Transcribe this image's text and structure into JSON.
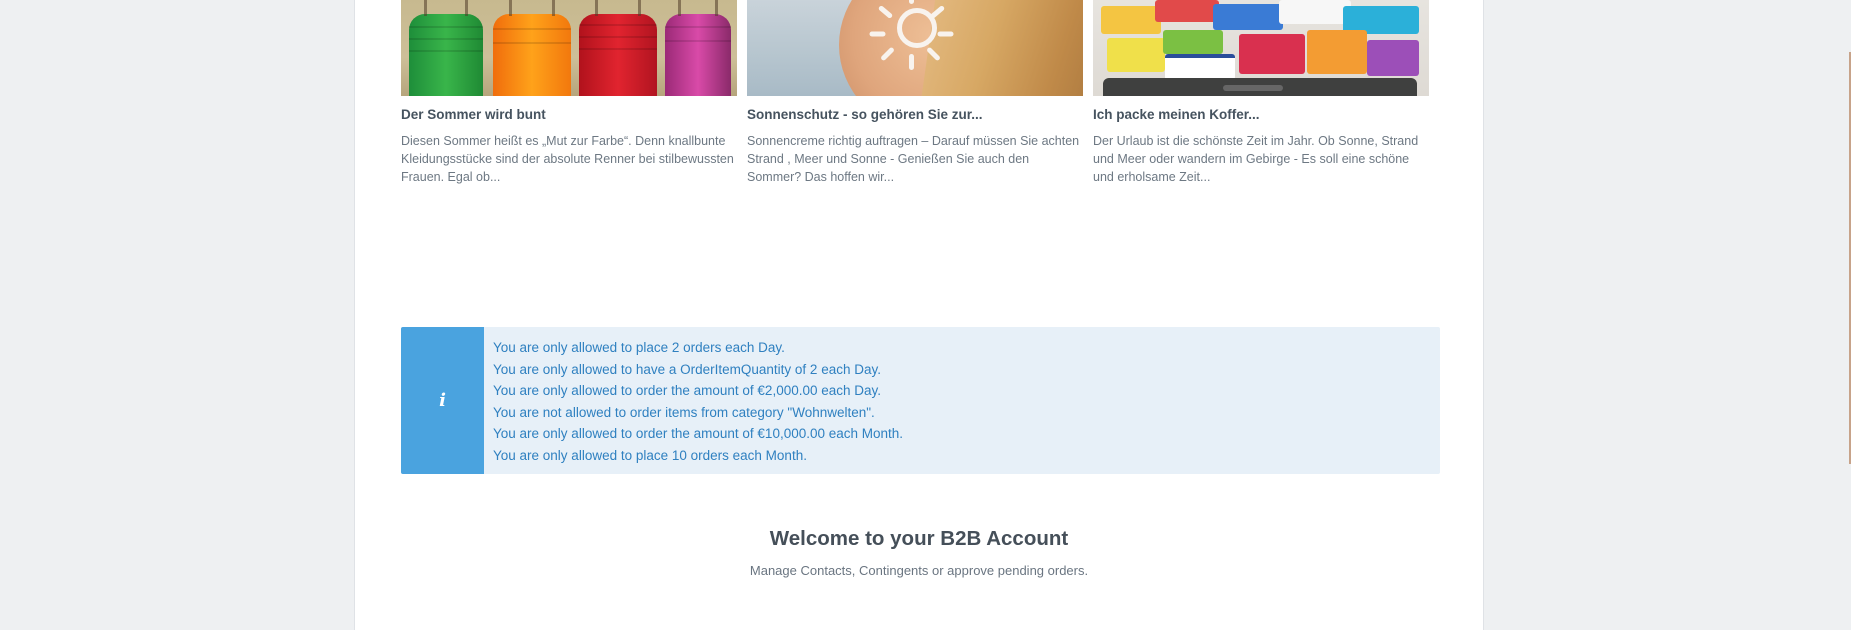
{
  "blog": {
    "items": [
      {
        "title": "Der Sommer wird bunt",
        "teaser": "Diesen Sommer heißt es „Mut zur Farbe“. Denn knallbunte Kleidungsstücke sind der absolute Renner bei stilbewussten Frauen. Egal ob...",
        "image_icon": "dresses-image"
      },
      {
        "title": "Sonnenschutz - so gehören Sie zur...",
        "teaser": "Sonnencreme richtig auftragen – Darauf müssen Sie achten Strand , Meer und Sonne - Genießen Sie auch den Sommer? Das hoffen wir...",
        "image_icon": "sunscreen-image"
      },
      {
        "title": "Ich packe meinen Koffer...",
        "teaser": "Der Urlaub ist die schönste Zeit im Jahr. Ob Sonne, Strand und Meer oder wandern im Gebirge - Es soll eine schöne und erholsame Zeit...",
        "image_icon": "suitcase-image"
      }
    ]
  },
  "alert": {
    "icon": "info-icon",
    "icon_glyph": "i",
    "accent_color": "#4aa3df",
    "background_color": "#e7f0f8",
    "text_color": "#2f80c0",
    "messages": [
      "You are only allowed to place 2 orders each Day.",
      "You are only allowed to have a OrderItemQuantity of 2 each Day.",
      "You are only allowed to order the amount of €2,000.00 each Day.",
      "You are not allowed to order items from category \"Wohnwelten\".",
      "You are only allowed to order the amount of €10,000.00 each Month.",
      "You are only allowed to place 10 orders each Month."
    ]
  },
  "welcome": {
    "title": "Welcome to your B2B Account",
    "subtitle": "Manage Contacts, Contingents or approve pending orders."
  }
}
